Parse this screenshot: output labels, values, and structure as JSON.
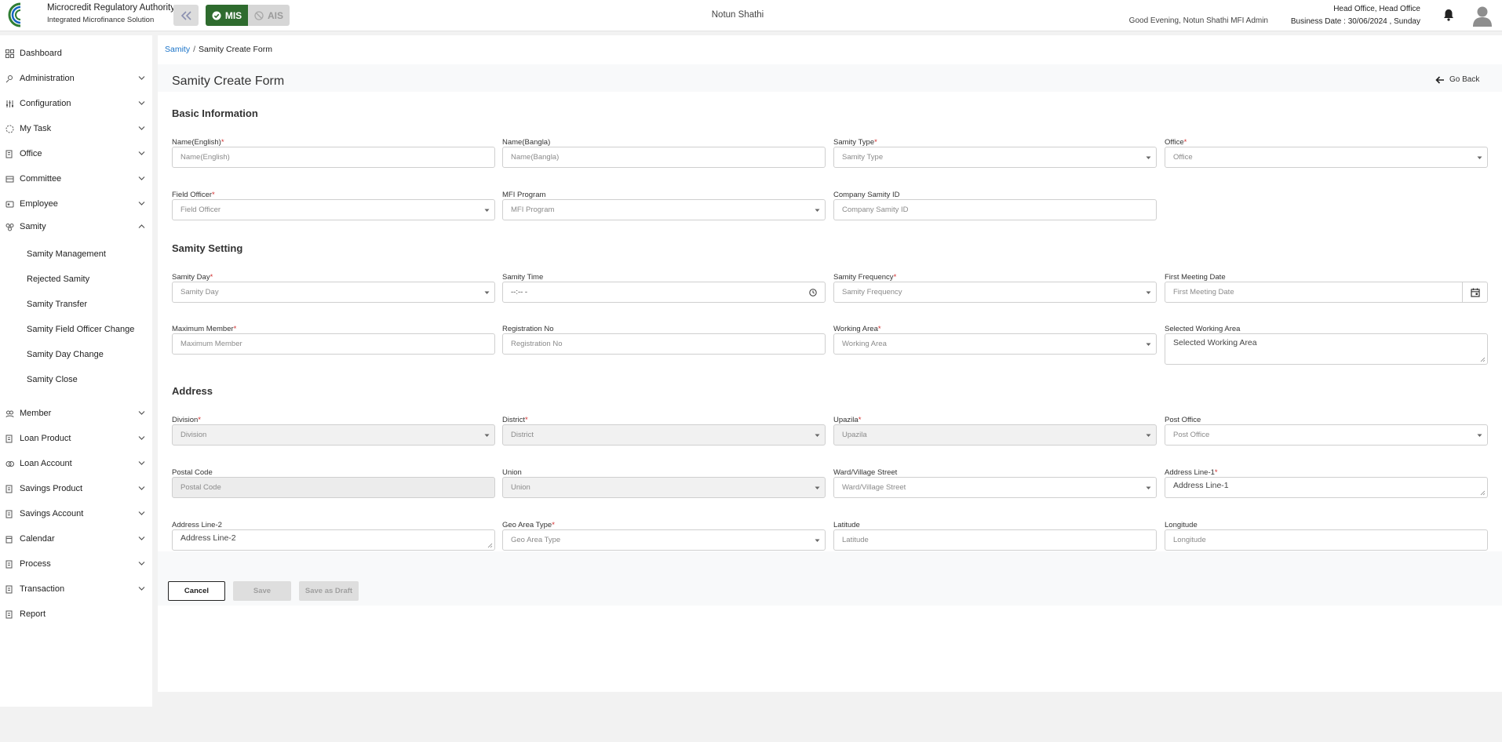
{
  "header": {
    "org_name": "Microcredit Regulatory Authority",
    "org_sub": "Integrated Microfinance Solution",
    "logo_text": "Microcredit Regulatory Authority",
    "mode_active": "MIS",
    "mode_inactive": "AIS",
    "center_title": "Notun Shathi",
    "greeting": "Good Evening, Notun Shathi MFI Admin",
    "office": "Head Office, Head Office",
    "business_date": "Business Date : 30/06/2024 , Sunday",
    "accent_color": "#2e6b2e"
  },
  "sidebar": {
    "items": [
      {
        "label": "Dashboard",
        "icon": "dashboard-icon"
      },
      {
        "label": "Administration",
        "icon": "admin-icon"
      },
      {
        "label": "Configuration",
        "icon": "config-icon"
      },
      {
        "label": "My Task",
        "icon": "task-icon"
      },
      {
        "label": "Office",
        "icon": "office-icon"
      },
      {
        "label": "Committee",
        "icon": "committee-icon"
      },
      {
        "label": "Employee",
        "icon": "employee-icon"
      },
      {
        "label": "Samity",
        "icon": "samity-icon"
      },
      {
        "label": "Member",
        "icon": "member-icon"
      },
      {
        "label": "Loan Product",
        "icon": "loan-product-icon"
      },
      {
        "label": "Loan Account",
        "icon": "loan-account-icon"
      },
      {
        "label": "Savings Product",
        "icon": "savings-product-icon"
      },
      {
        "label": "Savings Account",
        "icon": "savings-account-icon"
      },
      {
        "label": "Calendar",
        "icon": "calendar-icon"
      },
      {
        "label": "Process",
        "icon": "process-icon"
      },
      {
        "label": "Transaction",
        "icon": "transaction-icon"
      },
      {
        "label": "Report",
        "icon": "report-icon"
      }
    ],
    "samity_sub": [
      "Samity Management",
      "Rejected Samity",
      "Samity Transfer",
      "Samity Field Officer Change",
      "Samity Day Change",
      "Samity Close"
    ]
  },
  "breadcrumb": {
    "parent": "Samity",
    "current": "Samity Create Form"
  },
  "form": {
    "title": "Samity Create Form",
    "go_back": "Go Back",
    "sections": {
      "basic": "Basic Information",
      "setting": "Samity Setting",
      "address": "Address"
    },
    "fields": {
      "name_en": {
        "label": "Name(English)",
        "placeholder": "Name(English)"
      },
      "name_bn": {
        "label": "Name(Bangla)",
        "placeholder": "Name(Bangla)"
      },
      "samity_type": {
        "label": "Samity Type",
        "placeholder": "Samity Type"
      },
      "office": {
        "label": "Office",
        "placeholder": "Office"
      },
      "field_officer": {
        "label": "Field Officer",
        "placeholder": "Field Officer"
      },
      "mfi_program": {
        "label": "MFI Program",
        "placeholder": "MFI Program"
      },
      "company_samity_id": {
        "label": "Company Samity ID",
        "placeholder": "Company Samity ID"
      },
      "samity_day": {
        "label": "Samity Day",
        "placeholder": "Samity Day"
      },
      "samity_time": {
        "label": "Samity Time",
        "placeholder": "--:-- -"
      },
      "samity_frequency": {
        "label": "Samity Frequency",
        "placeholder": "Samity Frequency"
      },
      "first_meeting_date": {
        "label": "First Meeting Date",
        "placeholder": "First Meeting Date"
      },
      "maximum_member": {
        "label": "Maximum Member",
        "placeholder": "Maximum Member"
      },
      "registration_no": {
        "label": "Registration No",
        "placeholder": "Registration No"
      },
      "working_area": {
        "label": "Working Area",
        "placeholder": "Working Area"
      },
      "selected_working_area": {
        "label": "Selected Working Area",
        "placeholder": "Selected Working Area"
      },
      "division": {
        "label": "Division",
        "placeholder": "Division"
      },
      "district": {
        "label": "District",
        "placeholder": "District"
      },
      "upazila": {
        "label": "Upazila",
        "placeholder": "Upazila"
      },
      "post_office": {
        "label": "Post Office",
        "placeholder": "Post Office"
      },
      "postal_code": {
        "label": "Postal Code",
        "placeholder": "Postal Code"
      },
      "union": {
        "label": "Union",
        "placeholder": "Union"
      },
      "ward": {
        "label": "Ward/Village Street",
        "placeholder": "Ward/Village Street"
      },
      "address_line_1": {
        "label": "Address Line-1",
        "placeholder": "Address Line-1"
      },
      "address_line_2": {
        "label": "Address Line-2",
        "placeholder": "Address Line-2"
      },
      "geo_area_type": {
        "label": "Geo Area Type",
        "placeholder": "Geo Area Type"
      },
      "latitude": {
        "label": "Latitude",
        "placeholder": "Latitude"
      },
      "longitude": {
        "label": "Longitude",
        "placeholder": "Longitude"
      }
    },
    "required_mark": "*",
    "buttons": {
      "cancel": "Cancel",
      "save": "Save",
      "draft": "Save as Draft"
    }
  }
}
